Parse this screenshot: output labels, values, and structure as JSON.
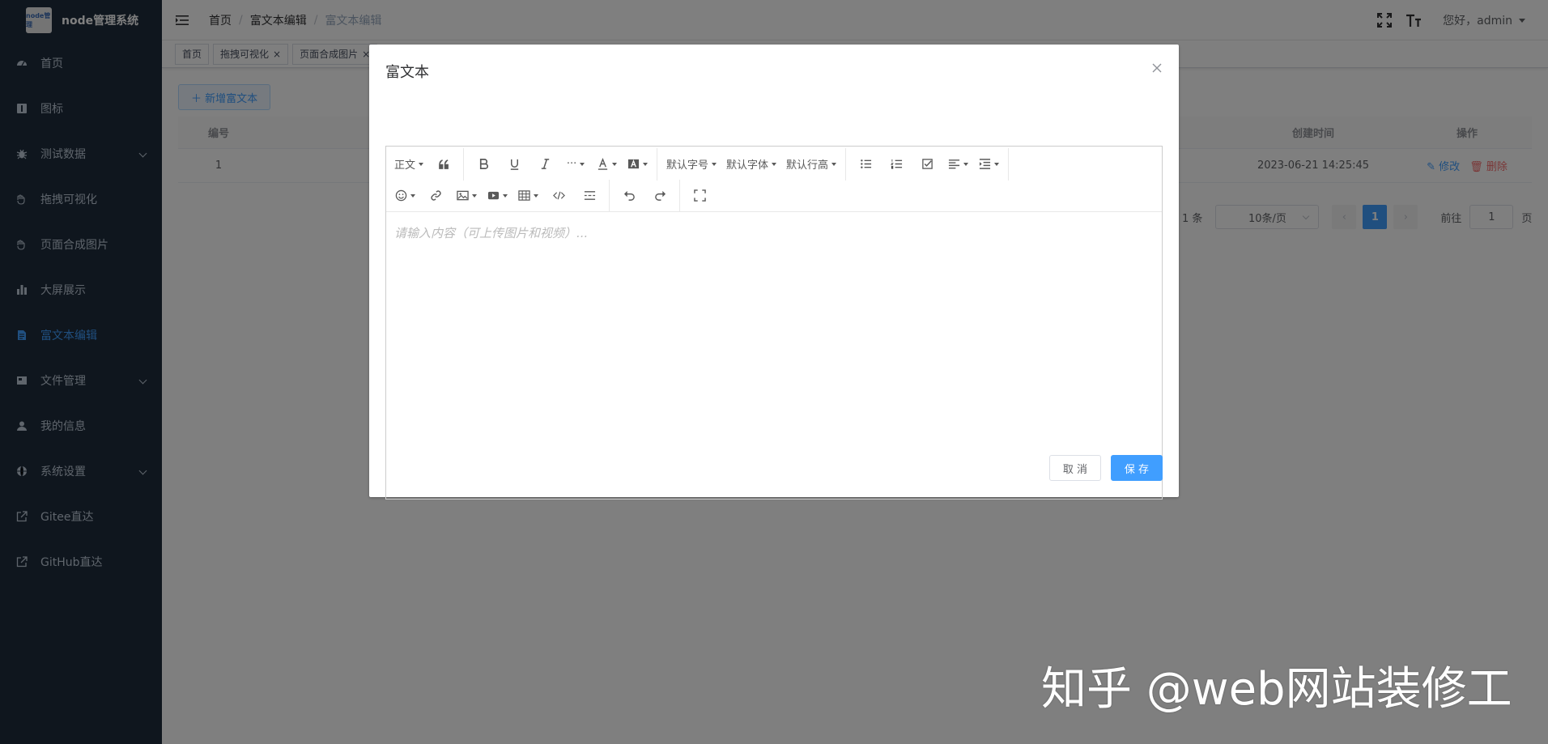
{
  "sidebar": {
    "logo_text": "node管理",
    "title": "node管理系统",
    "items": [
      {
        "label": "首页",
        "icon": "dashboard-icon",
        "has_arrow": false,
        "active": false
      },
      {
        "label": "图标",
        "icon": "icon-icon",
        "has_arrow": false,
        "active": false
      },
      {
        "label": "测试数据",
        "icon": "bug-icon",
        "has_arrow": true,
        "active": false
      },
      {
        "label": "拖拽可视化",
        "icon": "drag-icon",
        "has_arrow": false,
        "active": false
      },
      {
        "label": "页面合成图片",
        "icon": "picture-icon",
        "has_arrow": false,
        "active": false
      },
      {
        "label": "大屏展示",
        "icon": "chart-icon",
        "has_arrow": false,
        "active": false
      },
      {
        "label": "富文本编辑",
        "icon": "document-icon",
        "has_arrow": false,
        "active": true
      },
      {
        "label": "文件管理",
        "icon": "folder-icon",
        "has_arrow": true,
        "active": false
      },
      {
        "label": "我的信息",
        "icon": "user-icon",
        "has_arrow": false,
        "active": false
      },
      {
        "label": "系统设置",
        "icon": "settings-icon",
        "has_arrow": true,
        "active": false
      },
      {
        "label": "Gitee直达",
        "icon": "external-link-icon",
        "has_arrow": false,
        "active": false
      },
      {
        "label": "GitHub直达",
        "icon": "external-link-icon",
        "has_arrow": false,
        "active": false
      }
    ]
  },
  "navbar": {
    "breadcrumb": [
      "首页",
      "富文本编辑",
      "富文本编辑"
    ],
    "user_label": "您好，admin"
  },
  "tags": [
    {
      "label": "首页",
      "closable": false,
      "active": false
    },
    {
      "label": "拖拽可视化",
      "closable": true,
      "active": false
    },
    {
      "label": "页面合成图片",
      "closable": true,
      "active": false
    }
  ],
  "content": {
    "add_button": "＋ 新增富文本",
    "table": {
      "headers": {
        "id": "编号",
        "time": "创建时间",
        "op": "操作"
      },
      "rows": [
        {
          "id": "1",
          "time": "2023-06-21 14:25:45",
          "edit": "修改",
          "delete": "删除"
        }
      ]
    },
    "pagination": {
      "total": "1 条",
      "page_size": "10条/页",
      "current_page": "1",
      "goto_label": "前往",
      "goto_value": "1",
      "page_suffix": "页"
    }
  },
  "dialog": {
    "title": "富文本",
    "toolbar": {
      "paragraph": "正文",
      "font_size": "默认字号",
      "font_family": "默认字体",
      "line_height": "默认行高"
    },
    "placeholder": "请输入内容（可上传图片和视频）...",
    "cancel": "取 消",
    "save": "保 存"
  },
  "watermark": "知乎 @web网站装修工",
  "colors": {
    "sidebar_bg": "#1f2d3d",
    "accent": "#409eff",
    "danger": "#f56c6c"
  }
}
